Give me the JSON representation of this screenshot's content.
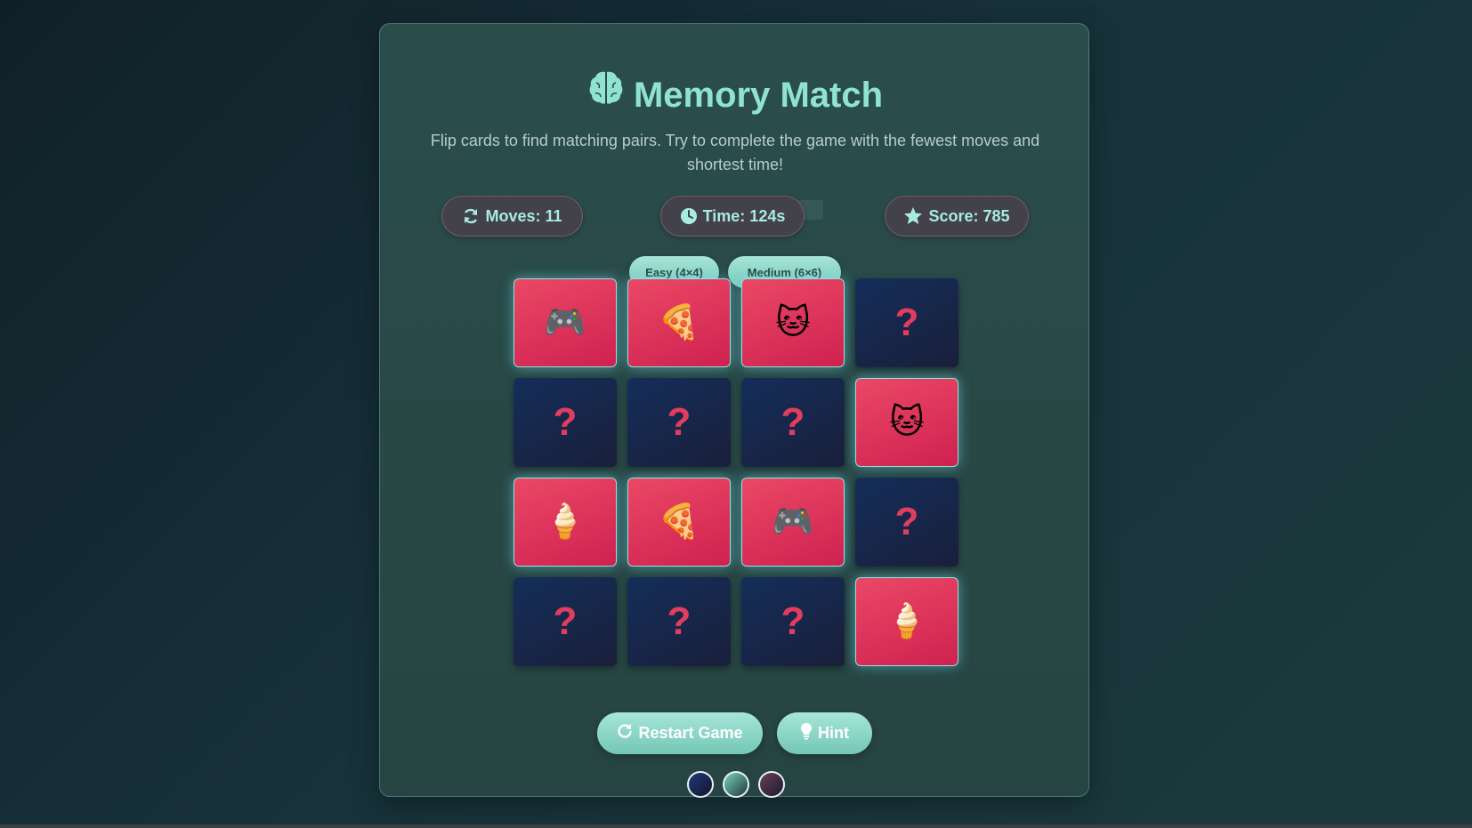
{
  "game": {
    "title": "Memory Match",
    "subtitle": "Flip cards to find matching pairs. Try to complete the game with the fewest moves and shortest time!",
    "colors": {
      "accent": "#8fe3d0",
      "card_back": "#142e5a",
      "card_face": "#e23c5e",
      "panel": "#2a4d4c"
    }
  },
  "stats": {
    "moves": "Moves: 11",
    "time": "Time: 124s",
    "score": "Score: 785",
    "icons": [
      "refresh-icon",
      "clock-icon",
      "star-icon"
    ]
  },
  "difficulty": {
    "easy": "Easy (4×4)",
    "medium": "Medium (6×6)"
  },
  "board": {
    "rows": 4,
    "cols": 4,
    "back_symbol": "?",
    "cards": [
      {
        "face": "🎮",
        "name": "game-controller",
        "flipped": true
      },
      {
        "face": "🍕",
        "name": "pizza",
        "flipped": true
      },
      {
        "face": "🐱",
        "name": "cat",
        "flipped": true
      },
      {
        "face": "",
        "name": "hidden",
        "flipped": false
      },
      {
        "face": "",
        "name": "hidden",
        "flipped": false
      },
      {
        "face": "",
        "name": "hidden",
        "flipped": false
      },
      {
        "face": "",
        "name": "hidden",
        "flipped": false
      },
      {
        "face": "🐱",
        "name": "cat",
        "flipped": true
      },
      {
        "face": "🍦",
        "name": "ice-cream",
        "flipped": true
      },
      {
        "face": "🍕",
        "name": "pizza",
        "flipped": true
      },
      {
        "face": "🎮",
        "name": "game-controller",
        "flipped": true
      },
      {
        "face": "",
        "name": "hidden",
        "flipped": false
      },
      {
        "face": "",
        "name": "hidden",
        "flipped": false
      },
      {
        "face": "",
        "name": "hidden",
        "flipped": false
      },
      {
        "face": "",
        "name": "hidden",
        "flipped": false
      },
      {
        "face": "🍦",
        "name": "ice-cream",
        "flipped": true
      }
    ]
  },
  "actions": {
    "restart": "Restart Game",
    "hint": "Hint",
    "icons": [
      "redo-icon",
      "lightbulb-icon"
    ]
  },
  "themes": {
    "options": [
      "dark-blue",
      "teal",
      "plum"
    ]
  }
}
